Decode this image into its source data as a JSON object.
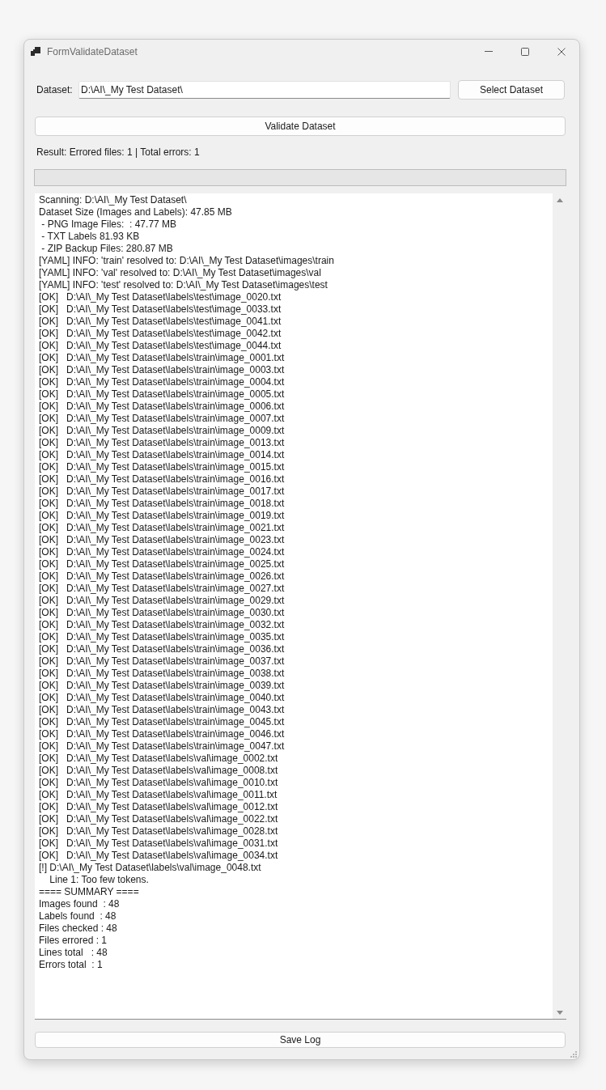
{
  "window": {
    "title": "FormValidateDataset"
  },
  "dataset_field": {
    "label": "Dataset:",
    "value": "D:\\AI\\_My Test Dataset\\"
  },
  "select_button": "Select Dataset",
  "validate_button": "Validate Dataset",
  "result": "Result: Errored files: 1 | Total errors: 1",
  "progress": {
    "level": 0
  },
  "log": {
    "lines": [
      "Scanning: D:\\AI\\_My Test Dataset\\",
      "Dataset Size (Images and Labels): 47.85 MB",
      " - PNG Image Files:  : 47.77 MB",
      " - TXT Labels 81.93 KB",
      " - ZIP Backup Files: 280.87 MB",
      "[YAML] INFO: 'train' resolved to: D:\\AI\\_My Test Dataset\\images\\train",
      "[YAML] INFO: 'val' resolved to: D:\\AI\\_My Test Dataset\\images\\val",
      "[YAML] INFO: 'test' resolved to: D:\\AI\\_My Test Dataset\\images\\test",
      "[OK]   D:\\AI\\_My Test Dataset\\labels\\test\\image_0020.txt",
      "[OK]   D:\\AI\\_My Test Dataset\\labels\\test\\image_0033.txt",
      "[OK]   D:\\AI\\_My Test Dataset\\labels\\test\\image_0041.txt",
      "[OK]   D:\\AI\\_My Test Dataset\\labels\\test\\image_0042.txt",
      "[OK]   D:\\AI\\_My Test Dataset\\labels\\test\\image_0044.txt",
      "[OK]   D:\\AI\\_My Test Dataset\\labels\\train\\image_0001.txt",
      "[OK]   D:\\AI\\_My Test Dataset\\labels\\train\\image_0003.txt",
      "[OK]   D:\\AI\\_My Test Dataset\\labels\\train\\image_0004.txt",
      "[OK]   D:\\AI\\_My Test Dataset\\labels\\train\\image_0005.txt",
      "[OK]   D:\\AI\\_My Test Dataset\\labels\\train\\image_0006.txt",
      "[OK]   D:\\AI\\_My Test Dataset\\labels\\train\\image_0007.txt",
      "[OK]   D:\\AI\\_My Test Dataset\\labels\\train\\image_0009.txt",
      "[OK]   D:\\AI\\_My Test Dataset\\labels\\train\\image_0013.txt",
      "[OK]   D:\\AI\\_My Test Dataset\\labels\\train\\image_0014.txt",
      "[OK]   D:\\AI\\_My Test Dataset\\labels\\train\\image_0015.txt",
      "[OK]   D:\\AI\\_My Test Dataset\\labels\\train\\image_0016.txt",
      "[OK]   D:\\AI\\_My Test Dataset\\labels\\train\\image_0017.txt",
      "[OK]   D:\\AI\\_My Test Dataset\\labels\\train\\image_0018.txt",
      "[OK]   D:\\AI\\_My Test Dataset\\labels\\train\\image_0019.txt",
      "[OK]   D:\\AI\\_My Test Dataset\\labels\\train\\image_0021.txt",
      "[OK]   D:\\AI\\_My Test Dataset\\labels\\train\\image_0023.txt",
      "[OK]   D:\\AI\\_My Test Dataset\\labels\\train\\image_0024.txt",
      "[OK]   D:\\AI\\_My Test Dataset\\labels\\train\\image_0025.txt",
      "[OK]   D:\\AI\\_My Test Dataset\\labels\\train\\image_0026.txt",
      "[OK]   D:\\AI\\_My Test Dataset\\labels\\train\\image_0027.txt",
      "[OK]   D:\\AI\\_My Test Dataset\\labels\\train\\image_0029.txt",
      "[OK]   D:\\AI\\_My Test Dataset\\labels\\train\\image_0030.txt",
      "[OK]   D:\\AI\\_My Test Dataset\\labels\\train\\image_0032.txt",
      "[OK]   D:\\AI\\_My Test Dataset\\labels\\train\\image_0035.txt",
      "[OK]   D:\\AI\\_My Test Dataset\\labels\\train\\image_0036.txt",
      "[OK]   D:\\AI\\_My Test Dataset\\labels\\train\\image_0037.txt",
      "[OK]   D:\\AI\\_My Test Dataset\\labels\\train\\image_0038.txt",
      "[OK]   D:\\AI\\_My Test Dataset\\labels\\train\\image_0039.txt",
      "[OK]   D:\\AI\\_My Test Dataset\\labels\\train\\image_0040.txt",
      "[OK]   D:\\AI\\_My Test Dataset\\labels\\train\\image_0043.txt",
      "[OK]   D:\\AI\\_My Test Dataset\\labels\\train\\image_0045.txt",
      "[OK]   D:\\AI\\_My Test Dataset\\labels\\train\\image_0046.txt",
      "[OK]   D:\\AI\\_My Test Dataset\\labels\\train\\image_0047.txt",
      "[OK]   D:\\AI\\_My Test Dataset\\labels\\val\\image_0002.txt",
      "[OK]   D:\\AI\\_My Test Dataset\\labels\\val\\image_0008.txt",
      "[OK]   D:\\AI\\_My Test Dataset\\labels\\val\\image_0010.txt",
      "[OK]   D:\\AI\\_My Test Dataset\\labels\\val\\image_0011.txt",
      "[OK]   D:\\AI\\_My Test Dataset\\labels\\val\\image_0012.txt",
      "[OK]   D:\\AI\\_My Test Dataset\\labels\\val\\image_0022.txt",
      "[OK]   D:\\AI\\_My Test Dataset\\labels\\val\\image_0028.txt",
      "[OK]   D:\\AI\\_My Test Dataset\\labels\\val\\image_0031.txt",
      "[OK]   D:\\AI\\_My Test Dataset\\labels\\val\\image_0034.txt",
      "[!] D:\\AI\\_My Test Dataset\\labels\\val\\image_0048.txt",
      "    Line 1: Too few tokens.",
      "==== SUMMARY ====",
      "Images found  : 48",
      "Labels found  : 48",
      "Files checked : 48",
      "Files errored : 1",
      "Lines total   : 48",
      "Errors total  : 1"
    ]
  },
  "save_button": "Save Log"
}
